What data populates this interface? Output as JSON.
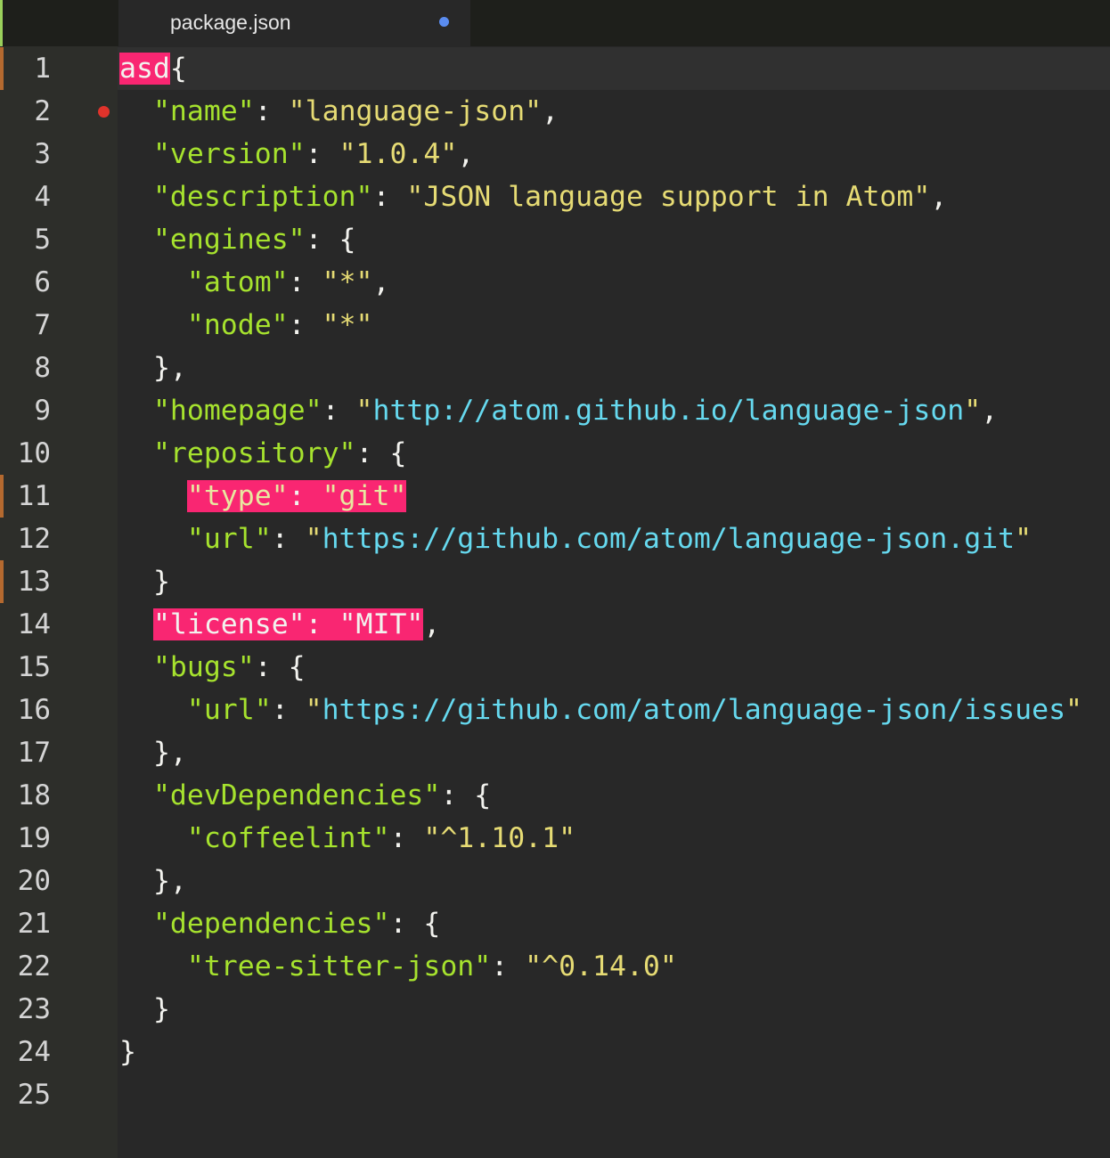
{
  "tab": {
    "title": "package.json",
    "modified": true
  },
  "colors": {
    "key": "#a6e22e",
    "string": "#e6db74",
    "url": "#66d9ef",
    "highlight": "#f92672",
    "breakpoint": "#e0332b",
    "git_modified": "#b4692f",
    "modified_dot": "#5a8cf0"
  },
  "editor": {
    "cursor_line": 1,
    "git_modified_lines": [
      1,
      11,
      13
    ],
    "breakpoint_lines": [
      2
    ],
    "lines": [
      [
        {
          "t": "asd",
          "c": "hl-plain"
        },
        {
          "t": "{",
          "c": "punc"
        }
      ],
      [
        {
          "t": "  "
        },
        {
          "t": "\"name\"",
          "c": "key"
        },
        {
          "t": ": ",
          "c": "punc"
        },
        {
          "t": "\"language-json\"",
          "c": "str"
        },
        {
          "t": ",",
          "c": "punc"
        }
      ],
      [
        {
          "t": "  "
        },
        {
          "t": "\"version\"",
          "c": "key"
        },
        {
          "t": ": ",
          "c": "punc"
        },
        {
          "t": "\"1.0.4\"",
          "c": "str"
        },
        {
          "t": ",",
          "c": "punc"
        }
      ],
      [
        {
          "t": "  "
        },
        {
          "t": "\"description\"",
          "c": "key"
        },
        {
          "t": ": ",
          "c": "punc"
        },
        {
          "t": "\"JSON language support in Atom\"",
          "c": "str"
        },
        {
          "t": ",",
          "c": "punc"
        }
      ],
      [
        {
          "t": "  "
        },
        {
          "t": "\"engines\"",
          "c": "key"
        },
        {
          "t": ": {",
          "c": "punc"
        }
      ],
      [
        {
          "t": "    "
        },
        {
          "t": "\"atom\"",
          "c": "key"
        },
        {
          "t": ": ",
          "c": "punc"
        },
        {
          "t": "\"*\"",
          "c": "str"
        },
        {
          "t": ",",
          "c": "punc"
        }
      ],
      [
        {
          "t": "    "
        },
        {
          "t": "\"node\"",
          "c": "key"
        },
        {
          "t": ": ",
          "c": "punc"
        },
        {
          "t": "\"*\"",
          "c": "str"
        }
      ],
      [
        {
          "t": "  "
        },
        {
          "t": "},",
          "c": "punc"
        }
      ],
      [
        {
          "t": "  "
        },
        {
          "t": "\"homepage\"",
          "c": "key"
        },
        {
          "t": ": ",
          "c": "punc"
        },
        {
          "t": "\"",
          "c": "str"
        },
        {
          "t": "http://atom.github.io/language-json",
          "c": "url"
        },
        {
          "t": "\"",
          "c": "str"
        },
        {
          "t": ",",
          "c": "punc"
        }
      ],
      [
        {
          "t": "  "
        },
        {
          "t": "\"repository\"",
          "c": "key"
        },
        {
          "t": ": {",
          "c": "punc"
        }
      ],
      [
        {
          "t": "    "
        },
        {
          "t": "\"type\"",
          "c": "hl-key"
        },
        {
          "t": ": ",
          "c": "hl-plain"
        },
        {
          "t": "\"git\"",
          "c": "hl-key"
        }
      ],
      [
        {
          "t": "    "
        },
        {
          "t": "\"url\"",
          "c": "key"
        },
        {
          "t": ": ",
          "c": "punc"
        },
        {
          "t": "\"",
          "c": "str"
        },
        {
          "t": "https://github.com/atom/language-json.git",
          "c": "url"
        },
        {
          "t": "\"",
          "c": "str"
        }
      ],
      [
        {
          "t": "  "
        },
        {
          "t": "}",
          "c": "punc"
        }
      ],
      [
        {
          "t": "  "
        },
        {
          "t": "\"license\"",
          "c": "hl-plain"
        },
        {
          "t": ": ",
          "c": "hl-plain"
        },
        {
          "t": "\"MIT\"",
          "c": "hl-plain"
        },
        {
          "t": ",",
          "c": "punc"
        }
      ],
      [
        {
          "t": "  "
        },
        {
          "t": "\"bugs\"",
          "c": "key"
        },
        {
          "t": ": {",
          "c": "punc"
        }
      ],
      [
        {
          "t": "    "
        },
        {
          "t": "\"url\"",
          "c": "key"
        },
        {
          "t": ": ",
          "c": "punc"
        },
        {
          "t": "\"",
          "c": "str"
        },
        {
          "t": "https://github.com/atom/language-json/issues",
          "c": "url"
        },
        {
          "t": "\"",
          "c": "str"
        }
      ],
      [
        {
          "t": "  "
        },
        {
          "t": "},",
          "c": "punc"
        }
      ],
      [
        {
          "t": "  "
        },
        {
          "t": "\"devDependencies\"",
          "c": "key"
        },
        {
          "t": ": {",
          "c": "punc"
        }
      ],
      [
        {
          "t": "    "
        },
        {
          "t": "\"coffeelint\"",
          "c": "key"
        },
        {
          "t": ": ",
          "c": "punc"
        },
        {
          "t": "\"^1.10.1\"",
          "c": "str"
        }
      ],
      [
        {
          "t": "  "
        },
        {
          "t": "},",
          "c": "punc"
        }
      ],
      [
        {
          "t": "  "
        },
        {
          "t": "\"dependencies\"",
          "c": "key"
        },
        {
          "t": ": {",
          "c": "punc"
        }
      ],
      [
        {
          "t": "    "
        },
        {
          "t": "\"tree-sitter-json\"",
          "c": "key"
        },
        {
          "t": ": ",
          "c": "punc"
        },
        {
          "t": "\"^0.14.0\"",
          "c": "str"
        }
      ],
      [
        {
          "t": "  "
        },
        {
          "t": "}",
          "c": "punc"
        }
      ],
      [
        {
          "t": "}",
          "c": "punc"
        }
      ],
      []
    ]
  }
}
